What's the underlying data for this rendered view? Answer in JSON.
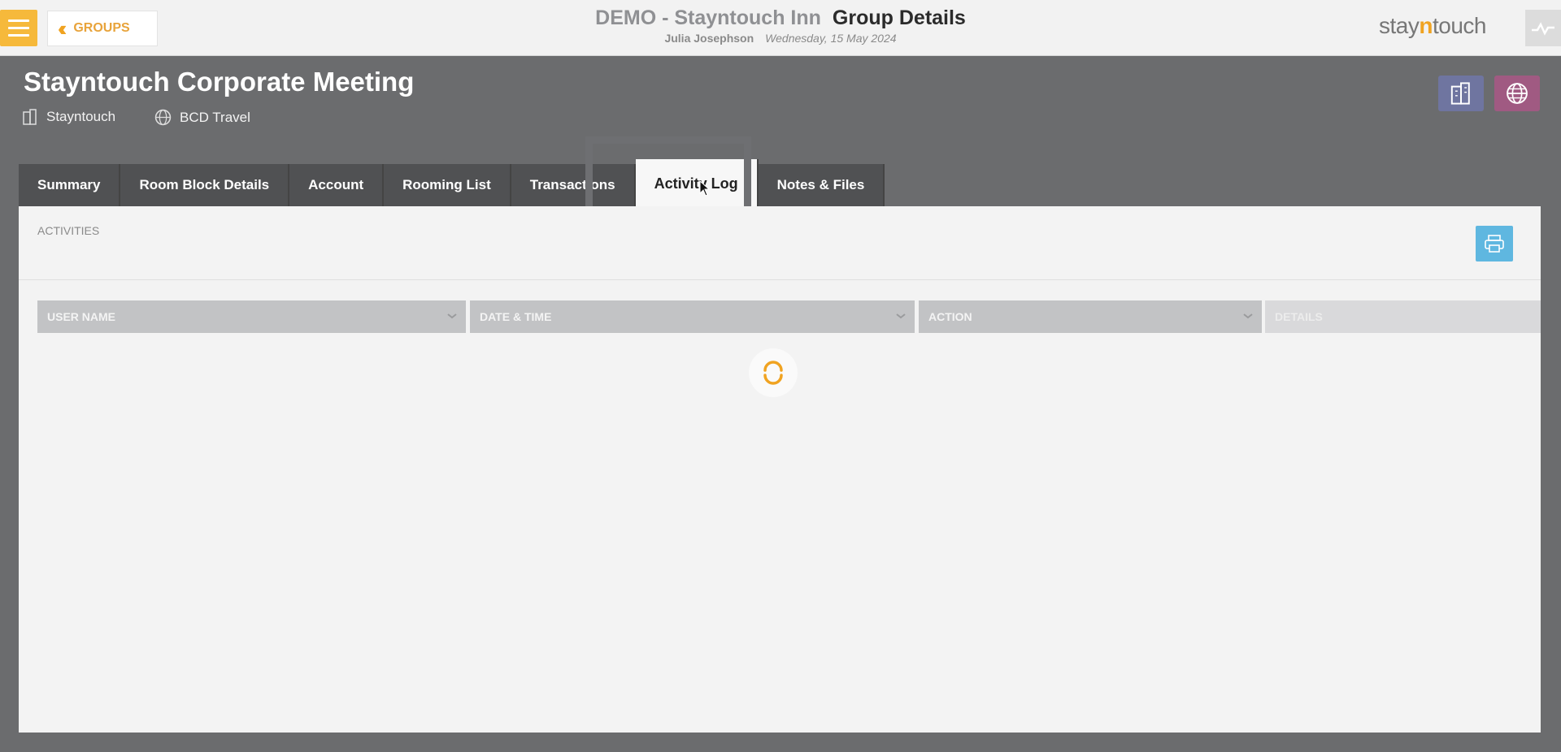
{
  "header": {
    "back_label": "GROUPS",
    "hotel_name": "DEMO - Stayntouch Inn",
    "page_title": "Group Details",
    "user_name": "Julia Josephson",
    "date": "Wednesday, 15 May 2024",
    "brand_pre": "stay",
    "brand_mid": "n",
    "brand_post": "touch",
    "accent_color": "#f6b93b"
  },
  "group": {
    "title": "Stayntouch Corporate Meeting",
    "company": "Stayntouch",
    "travel_agent": "BCD Travel"
  },
  "tabs": [
    {
      "label": "Summary",
      "active": false
    },
    {
      "label": "Room Block Details",
      "active": false
    },
    {
      "label": "Account",
      "active": false
    },
    {
      "label": "Rooming List",
      "active": false
    },
    {
      "label": "Transactions",
      "active": false
    },
    {
      "label": "Activity Log",
      "active": true
    },
    {
      "label": "Notes & Files",
      "active": false
    }
  ],
  "activities": {
    "section_label": "ACTIVITIES",
    "columns": [
      "USER NAME",
      "DATE & TIME",
      "ACTION",
      "DETAILS"
    ],
    "loading": true
  },
  "icons": {
    "menu": "hamburger-icon",
    "back": "double-chevron-left-icon",
    "activity": "pulse-icon",
    "company": "building-icon",
    "agent": "globe-icon",
    "print": "printer-icon",
    "sort": "chevron-down-icon",
    "spinner": "loading-spinner-icon"
  }
}
